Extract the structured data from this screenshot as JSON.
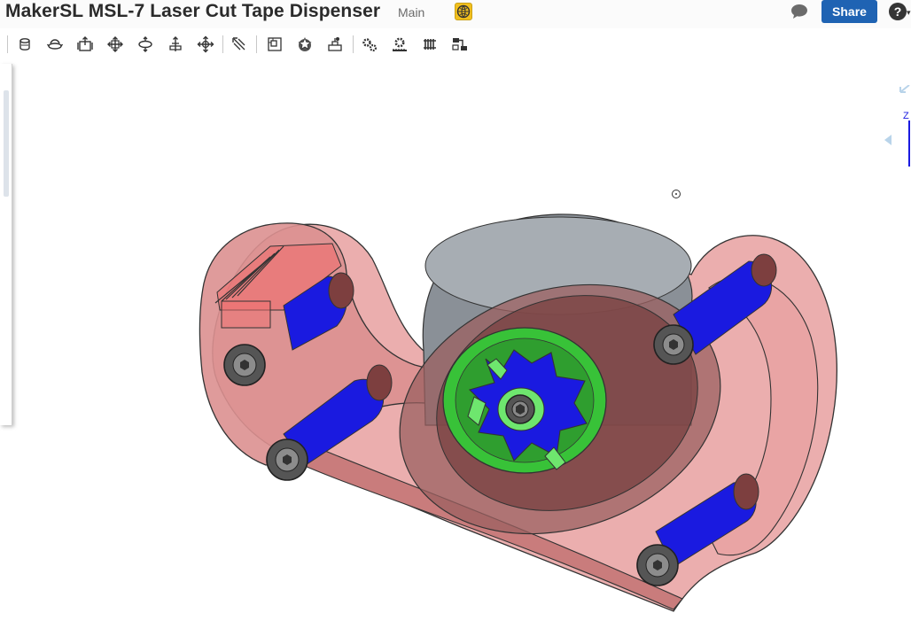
{
  "header": {
    "document_title": "MakerSL MSL-7 Laser Cut Tape Dispenser",
    "branch": "Main",
    "share_label": "Share",
    "help_label": "?",
    "icons": [
      "public-globe-icon",
      "comments-icon",
      "help-icon"
    ],
    "colors": {
      "share": "#1f63b3",
      "globe": "#f2c01d"
    }
  },
  "toolbar": {
    "tools": [
      "fixed-icon",
      "revolute-icon",
      "slider-icon",
      "planar-icon",
      "cylindrical-icon",
      "pin-slot-icon",
      "ball-icon",
      "tangent-mate-icon",
      "group-icon",
      "mate-connector-icon",
      "relation-icon",
      "gear-relation-icon",
      "rack-pinion-icon",
      "screw-relation-icon",
      "linear-pattern-icon"
    ]
  },
  "viewcube": {
    "axis_label": "Z"
  },
  "model": {
    "colors": {
      "body": "#e89a9a",
      "roller": "#1a1ae0",
      "hub": "#38c238",
      "tape": "#8a9097",
      "screw": "#3b3b3b"
    }
  }
}
